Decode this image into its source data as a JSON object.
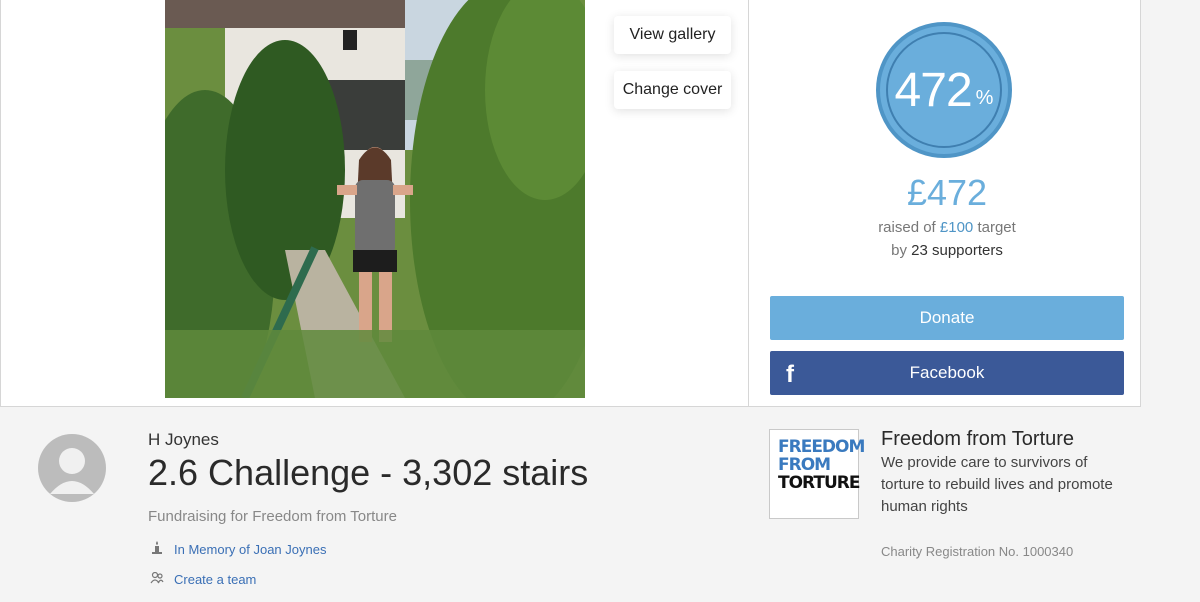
{
  "gallery": {
    "view_label": "View gallery",
    "change_label": "Change cover"
  },
  "progress": {
    "percent": "472",
    "percent_symbol": "%",
    "raised": "£472",
    "raised_prefix": "raised of",
    "target": "£100",
    "target_suffix": "target",
    "supporters_prefix": "by",
    "supporters_count": "23 supporters"
  },
  "actions": {
    "donate_label": "Donate",
    "facebook_label": "Facebook",
    "facebook_icon": "f"
  },
  "page": {
    "owner": "H Joynes",
    "title": "2.6 Challenge - 3,302 stairs",
    "fundraising_for": "Fundraising for Freedom from Torture",
    "memory_link": "In Memory of Joan Joynes",
    "team_link": "Create a team"
  },
  "charity": {
    "logo_lines": [
      "FREEDOM",
      "FROM",
      "TORTURE"
    ],
    "name": "Freedom from Torture",
    "description": "We provide care to survivors of torture to rebuild lives and promote human rights",
    "registration": "Charity Registration No. 1000340"
  },
  "colors": {
    "accent": "#6aaedc",
    "facebook": "#3b5998",
    "link": "#3a6fb5"
  }
}
